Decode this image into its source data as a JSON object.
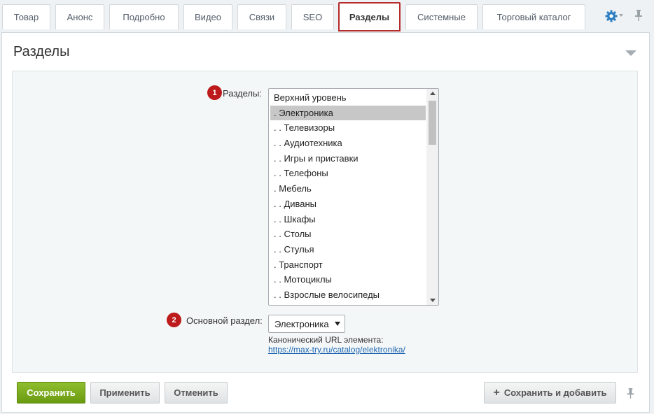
{
  "tabs": [
    {
      "label": "Товар"
    },
    {
      "label": "Анонс"
    },
    {
      "label": "Подробно"
    },
    {
      "label": "Видео"
    },
    {
      "label": "Связи"
    },
    {
      "label": "SEO"
    },
    {
      "label": "Разделы",
      "active": true
    },
    {
      "label": "Системные"
    },
    {
      "label": "Торговый каталог"
    }
  ],
  "panel": {
    "title": "Разделы"
  },
  "sections_field": {
    "badge": "1",
    "label": "Разделы:",
    "selected_item": ". Электроника",
    "items": [
      "Верхний уровень",
      ". Электроника",
      ". . Телевизоры",
      ". . Аудиотехника",
      ". . Игры и приставки",
      ". . Телефоны",
      ". Мебель",
      ". . Диваны",
      ". . Шкафы",
      ". . Столы",
      ". . Стулья",
      ". Транспорт",
      ". . Мотоциклы",
      ". . Взрослые велосипеды"
    ]
  },
  "main_section_field": {
    "badge": "2",
    "label": "Основной раздел:",
    "value": "Электроника",
    "canonical_label": "Канонический URL элемента:",
    "canonical_url": "https://max-try.ru/catalog/elektronika/"
  },
  "buttons": {
    "save": "Сохранить",
    "apply": "Применить",
    "cancel": "Отменить",
    "save_add": "Сохранить и добавить"
  },
  "colors": {
    "active_tab_border": "#b52a2a",
    "badge": "#bd1b1b",
    "save_button": "#7aab1c",
    "link": "#2067b0",
    "settings_icon": "#2f7fc1"
  }
}
